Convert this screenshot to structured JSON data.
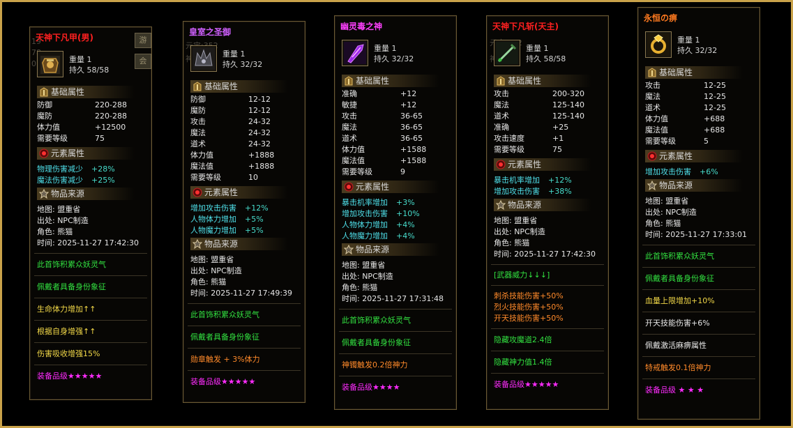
{
  "cards": [
    {
      "title": "天神下凡甲(男)",
      "title_color": "#ff2020",
      "weight": "重量 1",
      "durability": "持久 58/58",
      "base_label": "基础属性",
      "base": [
        [
          "防御",
          "220-288"
        ],
        [
          "魔防",
          "220-288"
        ],
        [
          "体力值",
          "+12500"
        ],
        [
          "需要等级",
          "75"
        ]
      ],
      "elem_label": "元素属性",
      "elem": [
        [
          "物理伤害减少",
          "+28%"
        ],
        [
          "魔法伤害减少",
          "+25%"
        ]
      ],
      "src_label": "物品来源",
      "src": [
        "地图: 盟重省",
        "出处: NPC制造",
        "角色: 熊猫",
        "时间: 2025-11-27 17:42:30"
      ],
      "extras": [
        [
          "此首饰积累众妖灵气",
          "gr"
        ],
        [
          "佩戴者具备身份象征",
          "gr"
        ],
        [
          "生命体力增加↑↑",
          "ye"
        ],
        [
          "根据自身增强↑↑",
          "ye"
        ],
        [
          "伤害吸收增强15%",
          "ye"
        ]
      ],
      "grade": "装备品级★★★★★",
      "ghost": [
        "19",
        "78",
        "07"
      ],
      "side": [
        "游",
        "会"
      ]
    },
    {
      "title": "皇室之圣御",
      "title_color": "#d060ff",
      "weight": "重量 1",
      "durability": "持久 32/32",
      "base_label": "基础属性",
      "base": [
        [
          "防御",
          "12-12"
        ],
        [
          "魔防",
          "12-12"
        ],
        [
          "攻击",
          "24-32"
        ],
        [
          "魔法",
          "24-32"
        ],
        [
          "道术",
          "24-32"
        ],
        [
          "体力值",
          "+1888"
        ],
        [
          "魔法值",
          "+1888"
        ],
        [
          "需要等级",
          "10"
        ]
      ],
      "elem_label": "元素属性",
      "elem": [
        [
          "增加攻击伤害",
          "+12%"
        ],
        [
          "人物体力增加",
          "+5%"
        ],
        [
          "人物魔力增加",
          "+5%"
        ]
      ],
      "src_label": "物品来源",
      "src": [
        "地图: 盟重省",
        "出处: NPC制造",
        "角色: 熊猫",
        "时间: 2025-11-27 17:49:39"
      ],
      "extras": [
        [
          "此首饰积累众妖灵气",
          "gr"
        ],
        [
          "佩戴者具备身份象征",
          "gr"
        ],
        [
          "勋章触发 + 3%体力",
          "or"
        ]
      ],
      "grade": "装备品级★★★★★",
      "ghost": [
        "元宝:352",
        "神"
      ]
    },
    {
      "title": "幽灵毒之神",
      "title_color": "#ff40ff",
      "weight": "重量 1",
      "durability": "持久 32/32",
      "base_label": "基础属性",
      "base": [
        [
          "准确",
          "+12"
        ],
        [
          "敏捷",
          "+12"
        ],
        [
          "攻击",
          "36-65"
        ],
        [
          "魔法",
          "36-65"
        ],
        [
          "道术",
          "36-65"
        ],
        [
          "体力值",
          "+1588"
        ],
        [
          "魔法值",
          "+1588"
        ],
        [
          "需要等级",
          "9"
        ]
      ],
      "elem_label": "元素属性",
      "elem": [
        [
          "暴击机率增加",
          "+3%"
        ],
        [
          "增加攻击伤害",
          "+10%"
        ],
        [
          "人物体力增加",
          "+4%"
        ],
        [
          "人物魔力增加",
          "+4%"
        ]
      ],
      "src_label": "物品来源",
      "src": [
        "地图: 盟重省",
        "出处: NPC制造",
        "角色: 熊猫",
        "时间: 2025-11-27 17:31:48"
      ],
      "extras": [
        [
          "此首饰积累众妖灵气",
          "gr"
        ],
        [
          "佩戴者具备身份象征",
          "gr"
        ],
        [
          "神镯触发0.2倍神力",
          "or"
        ]
      ],
      "grade": "装备品级★★★★",
      "ghost": []
    },
    {
      "title": "天神下凡斩(天主)",
      "title_color": "#ff2020",
      "weight": "重量 1",
      "durability": "持久 58/58",
      "base_label": "基础属性",
      "base": [
        [
          "攻击",
          "200-320"
        ],
        [
          "魔法",
          "125-140"
        ],
        [
          "道术",
          "125-140"
        ],
        [
          "准确",
          "+25"
        ],
        [
          "攻击速度",
          "+1"
        ],
        [
          "需要等级",
          "75"
        ]
      ],
      "elem_label": "元素属性",
      "elem": [
        [
          "暴击机率增加",
          "+12%"
        ],
        [
          "增加攻击伤害",
          "+38%"
        ]
      ],
      "src_label": "物品来源",
      "src": [
        "地图: 盟重省",
        "出处: NPC制造",
        "角色: 熊猫",
        "时间: 2025-11-27 17:42:30"
      ],
      "weapon_power": "[武器威力↓↓↓]",
      "skills": [
        "刺杀技能伤害+50%",
        "烈火技能伤害+50%",
        "开天技能伤害+50%"
      ],
      "extras": [
        [
          "隐藏攻魔道2.4倍",
          "gr"
        ],
        [
          "隐藏神力值1.4倍",
          "gr"
        ]
      ],
      "grade": "装备品级★★★★★",
      "ghost": [
        "元宝:352",
        "神"
      ]
    },
    {
      "title": "永恒の痹",
      "title_color": "#ff7a20",
      "weight": "重量 1",
      "durability": "持久 32/32",
      "base_label": "基础属性",
      "base": [
        [
          "攻击",
          "12-25"
        ],
        [
          "魔法",
          "12-25"
        ],
        [
          "道术",
          "12-25"
        ],
        [
          "体力值",
          "+688"
        ],
        [
          "魔法值",
          "+688"
        ],
        [
          "需要等级",
          "5"
        ]
      ],
      "elem_label": "元素属性",
      "elem": [
        [
          "增加攻击伤害",
          "+6%"
        ]
      ],
      "src_label": "物品来源",
      "src": [
        "地图: 盟重省",
        "出处: NPC制造",
        "角色: 熊猫",
        "时间: 2025-11-27 17:33:01"
      ],
      "extras": [
        [
          "此首饰积累众妖灵气",
          "gr"
        ],
        [
          "佩戴者具备身份象征",
          "gr"
        ],
        [
          "血量上限增加+10%",
          "ye"
        ],
        [
          "开天技能伤害+6%",
          "wh"
        ],
        [
          "佩戴激活麻痹属性",
          "wh"
        ],
        [
          "特戒触发0.1倍神力",
          "or"
        ]
      ],
      "grade": "装备品级 ★ ★ ★",
      "ghost": []
    }
  ],
  "colors": {
    "frame": "#c9a24a",
    "base_value": "#e6e6e6",
    "elem_value": "#4fe0ea",
    "green": "#32e040",
    "yellow": "#f2d848",
    "orange": "#ff8a2a",
    "grade": "#ff2cff"
  },
  "icons": [
    "armor-icon",
    "crown-helm-icon",
    "purple-dagger-icon",
    "green-sword-icon",
    "gold-ring-icon"
  ]
}
